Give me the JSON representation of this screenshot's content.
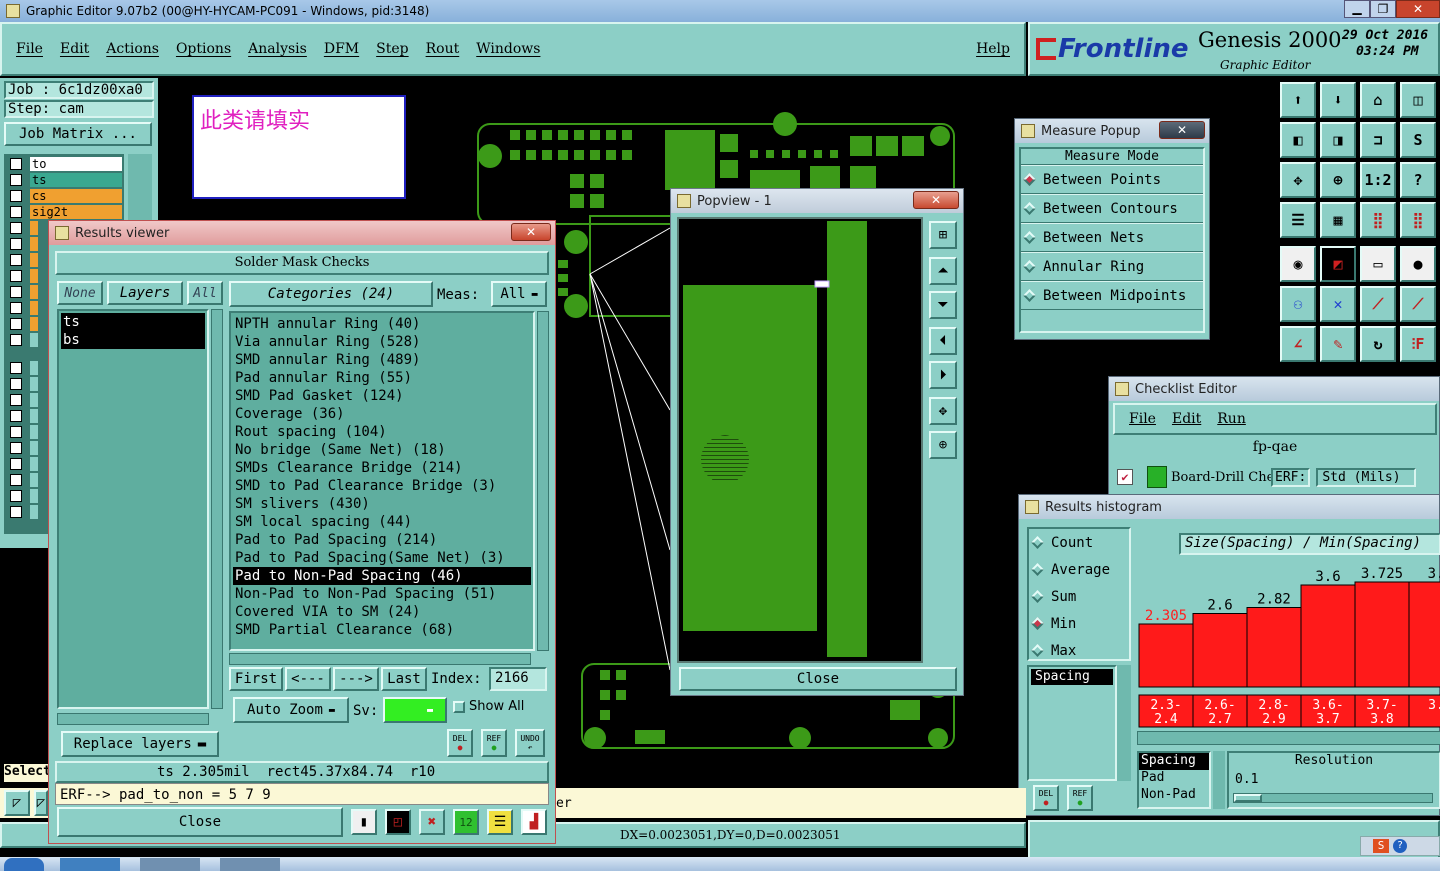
{
  "app": {
    "title": "Graphic Editor 9.07b2 (00@HY-HYCAM-PC091 - Windows, pid:3148)"
  },
  "menu": {
    "items": [
      "File",
      "Edit",
      "Actions",
      "Options",
      "Analysis",
      "DFM",
      "Step",
      "Rout",
      "Windows"
    ],
    "help": "Help"
  },
  "brand": {
    "logo": "Frontline",
    "product": "Genesis 2000",
    "subtitle": "Graphic Editor",
    "date": "29 Oct 2016",
    "time": "03:24 PM"
  },
  "job": {
    "job_label": "Job : 6c1dz00xa0",
    "step_label": "Step: cam",
    "matrix_button": "Job Matrix ..."
  },
  "layers": [
    {
      "name": "to",
      "color": "#ffffff"
    },
    {
      "name": "ts",
      "color": "#3aa890"
    },
    {
      "name": "cs",
      "color": "#f0a030"
    },
    {
      "name": "sig2t",
      "color": "#f0a030"
    }
  ],
  "note": {
    "text": "此类请填实"
  },
  "select_label": "Select",
  "results_viewer": {
    "title": "Results viewer",
    "header": "Solder Mask Checks",
    "none": "None",
    "layers": "Layers",
    "all": "All",
    "categories_btn": "Categories (24)",
    "meas_label": "Meas:",
    "meas_value": "All",
    "layer_items": [
      "ts",
      "bs"
    ],
    "categories": [
      "NPTH annular Ring (40)",
      "Via annular Ring (528)",
      "SMD annular Ring (489)",
      "Pad annular Ring (55)",
      "SMD Pad Gasket (124)",
      "Coverage (36)",
      "Rout spacing (104)",
      "No bridge (Same Net) (18)",
      "SMDs Clearance Bridge (214)",
      "SMD to Pad Clearance Bridge (3)",
      "SM slivers (430)",
      "SM local spacing (44)",
      "Pad to Pad Spacing (214)",
      "Pad to Pad Spacing(Same Net) (3)",
      "Pad to Non-Pad Spacing (46)",
      "Non-Pad to Non-Pad Spacing (51)",
      "Covered VIA to SM (24)",
      "SMD Partial Clearance (68)"
    ],
    "selected_index": 14,
    "first": "First",
    "prev": "<---",
    "next": "--->",
    "last": "Last",
    "index_label": "Index:",
    "index_value": "2166",
    "auto_zoom": "Auto Zoom",
    "sv_label": "Sv:",
    "show_all": "Show All",
    "replace_layers": "Replace layers",
    "del": "DEL",
    "ref": "REF",
    "undo": "UNDO",
    "status": "ts 2.305mil  rect45.37x84.74  r10",
    "erf": "ERF--> pad_to_non = 5 7 9",
    "close": "Close"
  },
  "popview": {
    "title": "Popview - 1",
    "close": "Close"
  },
  "measure": {
    "title": "Measure Popup",
    "mode": "Measure Mode",
    "options": [
      "Between Points",
      "Between Contours",
      "Between Nets",
      "Annular Ring",
      "Between Midpoints"
    ],
    "selected": 0
  },
  "checklist": {
    "title": "Checklist Editor",
    "menu": [
      "File",
      "Edit",
      "Run"
    ],
    "name": "fp-qae",
    "row_label": "Board-Drill Che",
    "erf_label": "ERF:",
    "erf_value": "Std (Mils)"
  },
  "histogram": {
    "title": "Results histogram",
    "options": [
      "Count",
      "Average",
      "Sum",
      "Min",
      "Max"
    ],
    "selected": 3,
    "header": "Size(Spacing) / Min(Spacing)",
    "list_sel": "Spacing",
    "bins": [
      {
        "value": "2.305",
        "range": "2.3-\n2.4",
        "h": 0.42
      },
      {
        "value": "2.6",
        "range": "2.6-\n2.7",
        "h": 0.49
      },
      {
        "value": "2.82",
        "range": "2.8-\n2.9",
        "h": 0.53
      },
      {
        "value": "3.6",
        "range": "3.6-\n3.7",
        "h": 0.68
      },
      {
        "value": "3.725",
        "range": "3.7-\n3.8",
        "h": 0.7
      },
      {
        "value": "3.",
        "range": "3.",
        "h": 0.7
      }
    ],
    "sub_list": [
      "Spacing",
      "Pad",
      "Non-Pad"
    ],
    "resolution_label": "Resolution",
    "resolution_value": "0.1",
    "del": "DEL",
    "ref": "REF"
  },
  "bottom": {
    "coords": "DX=0.0023051,DY=0,D=0.0023051",
    "er": "er"
  },
  "colors": {
    "teal": "#8ccfc6",
    "board": "#3c9a18",
    "bar": "#ff1a1a"
  }
}
